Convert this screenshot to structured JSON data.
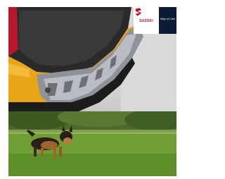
{
  "brand": {
    "name": "SUZUKI",
    "tagline": "Way of Life!",
    "logo_icon": "suzuki-s-logo-icon",
    "logo_color": "#d0021b",
    "strip_color": "#0b1a35"
  },
  "images": {
    "top": "car-rear-bumper-protector-photo",
    "bottom": "dog-running-on-grass-photo"
  }
}
